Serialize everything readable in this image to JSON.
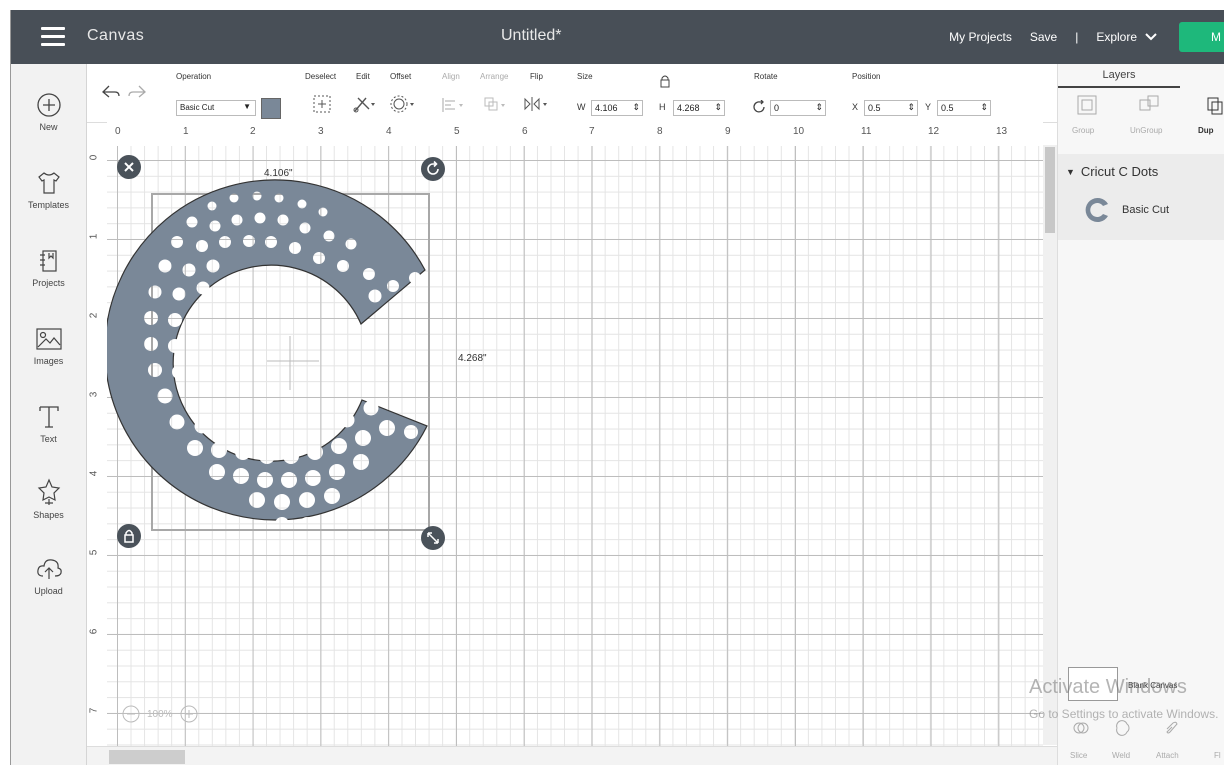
{
  "topbar": {
    "app_title": "Canvas",
    "doc_title": "Untitled*",
    "my_projects": "My Projects",
    "save": "Save",
    "separator": "|",
    "explore": "Explore",
    "make_label": "M",
    "make_color": "#1eb87b"
  },
  "sidebar": {
    "items": [
      {
        "label": "New",
        "icon": "plus-circle-icon"
      },
      {
        "label": "Templates",
        "icon": "tshirt-icon"
      },
      {
        "label": "Projects",
        "icon": "projects-icon"
      },
      {
        "label": "Images",
        "icon": "image-icon"
      },
      {
        "label": "Text",
        "icon": "text-icon"
      },
      {
        "label": "Shapes",
        "icon": "shapes-icon"
      },
      {
        "label": "Upload",
        "icon": "upload-icon"
      }
    ]
  },
  "toolbar": {
    "operation_label": "Operation",
    "operation_value": "Basic Cut",
    "operation_color": "#7a8898",
    "deselect": "Deselect",
    "edit": "Edit",
    "offset": "Offset",
    "align": "Align",
    "arrange": "Arrange",
    "flip": "Flip",
    "size_label": "Size",
    "w_label": "W",
    "w_value": "4.106",
    "h_label": "H",
    "h_value": "4.268",
    "rotate_label": "Rotate",
    "rotate_value": "0",
    "position_label": "Position",
    "x_label": "X",
    "x_value": "0.5",
    "y_label": "Y",
    "y_value": "0.5"
  },
  "ruler": {
    "top": [
      "0",
      "1",
      "2",
      "3",
      "4",
      "5",
      "6",
      "7",
      "8",
      "9",
      "10",
      "11",
      "12",
      "13"
    ],
    "left": [
      "0",
      "1",
      "2",
      "3",
      "4",
      "5",
      "6",
      "7"
    ]
  },
  "canvas": {
    "width_label": "4.106\"",
    "height_label": "4.268\"",
    "shape_color": "#7a8898",
    "zoom": "100%"
  },
  "layers": {
    "title": "Layers",
    "group": "Group",
    "ungroup": "UnGroup",
    "duplicate": "Dup",
    "group_name": "Cricut C Dots",
    "layer_name": "Basic Cut",
    "blank_canvas": "Blank Canvas",
    "slice": "Slice",
    "weld": "Weld",
    "attach": "Attach",
    "flatten": "Fl"
  },
  "watermark": {
    "line1": "Activate Windows",
    "line2": "Go to Settings to activate Windows."
  }
}
